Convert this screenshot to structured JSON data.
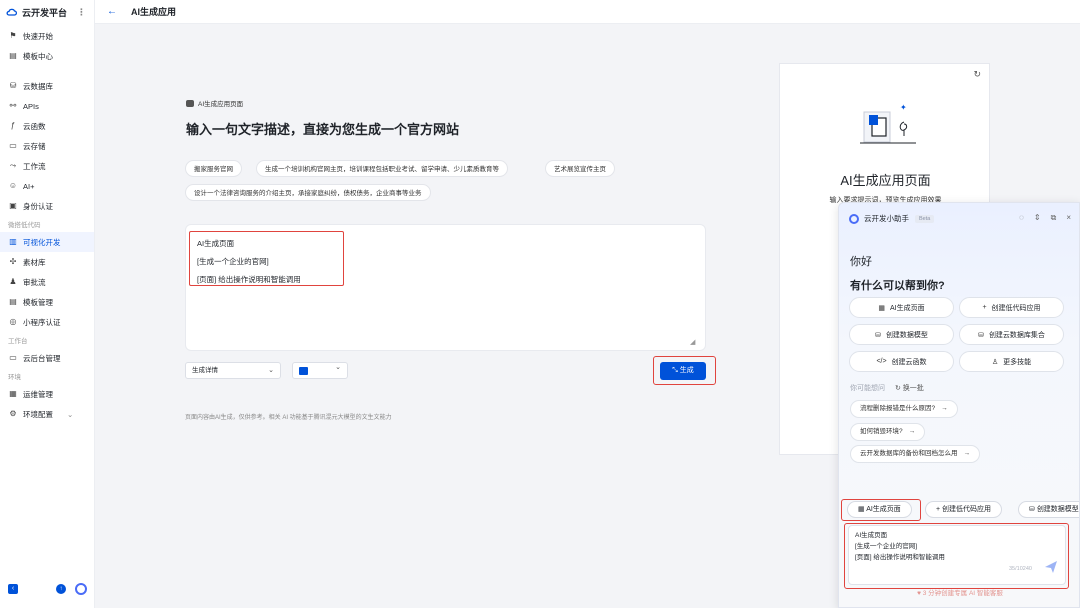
{
  "sidebar": {
    "brand": "云开发平台",
    "items_top": [
      {
        "icon": "flag-icon",
        "label": "快速开始"
      },
      {
        "icon": "template-icon",
        "label": "模板中心"
      }
    ],
    "items_main": [
      {
        "icon": "database-icon",
        "label": "云数据库"
      },
      {
        "icon": "api-icon",
        "label": "APIs"
      },
      {
        "icon": "function-icon",
        "label": "云函数"
      },
      {
        "icon": "storage-icon",
        "label": "云存储"
      },
      {
        "icon": "workflow-icon",
        "label": "工作流"
      },
      {
        "icon": "robot-icon",
        "label": "AI+"
      },
      {
        "icon": "id-card-icon",
        "label": "身份认证"
      }
    ],
    "group_lowcode": "微搭低代码",
    "items_lowcode": [
      {
        "icon": "visual-dev-icon",
        "label": "可视化开发"
      },
      {
        "icon": "assets-icon",
        "label": "素材库"
      },
      {
        "icon": "approval-icon",
        "label": "审批流"
      },
      {
        "icon": "template-manage-icon",
        "label": "模板管理"
      },
      {
        "icon": "miniprogram-icon",
        "label": "小程序认证"
      }
    ],
    "group_workbench": "工作台",
    "items_workbench": [
      {
        "icon": "console-icon",
        "label": "云后台管理"
      }
    ],
    "group_env": "环境",
    "items_env": [
      {
        "icon": "ops-icon",
        "label": "运维管理"
      },
      {
        "icon": "settings-icon",
        "label": "环境配置"
      }
    ]
  },
  "topbar": {
    "title": "AI生成应用"
  },
  "main": {
    "badge": "AI生成应用页面",
    "heading": "输入一句文字描述，直接为您生成一个官方网站",
    "chips": [
      "搬家服务官网",
      "生成一个培训机构官网主页，培训课程包括职业考试、留学申请、少儿素质教育等",
      "艺术展览宣传主页",
      "设计一个法律咨询服务的介绍主页，承接家庭纠纷，债权债务，企业商事等业务"
    ],
    "editor_lines": [
      "AI生成页面",
      "[生成一个企业的官网]",
      "[页面] 给出操作说明和智能调用"
    ],
    "select_detail": "生成详情",
    "generate_label": "生成",
    "disclaimer": "页面内容由AI生成，仅供参考。相关 AI 功能基于腾讯混元大模型的文生文能力"
  },
  "preview": {
    "title": "AI生成应用页面",
    "subtitle": "输入要求提示词，预览生成应用效果"
  },
  "assistant": {
    "name": "云开发小助手",
    "beta": "Beta",
    "greet1": "你好",
    "greet2": "有什么可以帮到你?",
    "quick": [
      {
        "icon": "grid-icon",
        "label": "AI生成页面"
      },
      {
        "icon": "plus-icon",
        "label": "创建低代码应用"
      },
      {
        "icon": "db-icon",
        "label": "创建数据模型"
      },
      {
        "icon": "db-icon",
        "label": "创建云数据库集合"
      },
      {
        "icon": "code-icon",
        "label": "创建云函数"
      },
      {
        "icon": "skill-icon",
        "label": "更多技能"
      }
    ],
    "maybe_label": "你可能想问",
    "switch_label": "换一批",
    "suggestions": [
      "流程删除报错是什么原因?",
      "如何销毁环境?",
      "云开发数据库的备份和回档怎么用"
    ],
    "chips": [
      "AI生成页面",
      "创建低代码应用",
      "创建数据模型"
    ],
    "input_lines": [
      "AI生成页面",
      "[生成一个企业的官网]",
      "[页面] 给出操作说明和智能调用"
    ],
    "count": "35/10240",
    "footer": "3 分钟创建专属 AI 智能客服"
  }
}
